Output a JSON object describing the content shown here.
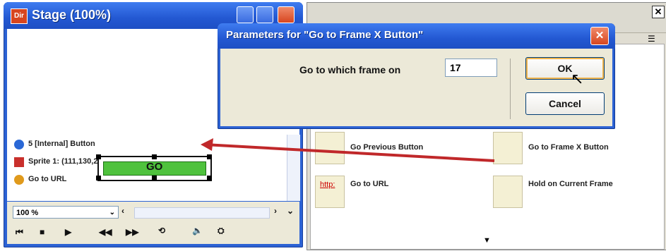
{
  "stage": {
    "logo": "Dir",
    "title": "Stage (100%)",
    "items": [
      {
        "label": "5 [Internal] Button"
      },
      {
        "label": "Sprite 1: (111,130,205,150) Copy, 100%"
      },
      {
        "label": "Go to URL"
      }
    ],
    "go_button_label": "GO",
    "zoom": "100 %"
  },
  "panel": {
    "close_label": "✕",
    "behaviors": [
      {
        "label": "Go Previous Button"
      },
      {
        "label": "Go to Frame X Button"
      },
      {
        "label": "Go to URL"
      },
      {
        "label": "Hold on Current Frame"
      }
    ],
    "url_icon_text": "http:"
  },
  "dialog": {
    "title": "Parameters for \"Go to Frame X Button\"",
    "close_label": "✕",
    "prompt": "Go to which frame on",
    "frame_value": "17",
    "ok_label": "OK",
    "cancel_label": "Cancel"
  },
  "colors": {
    "titlebar": "#2c62d4",
    "go_button": "#4fc23d",
    "arrow": "#c0282a"
  }
}
